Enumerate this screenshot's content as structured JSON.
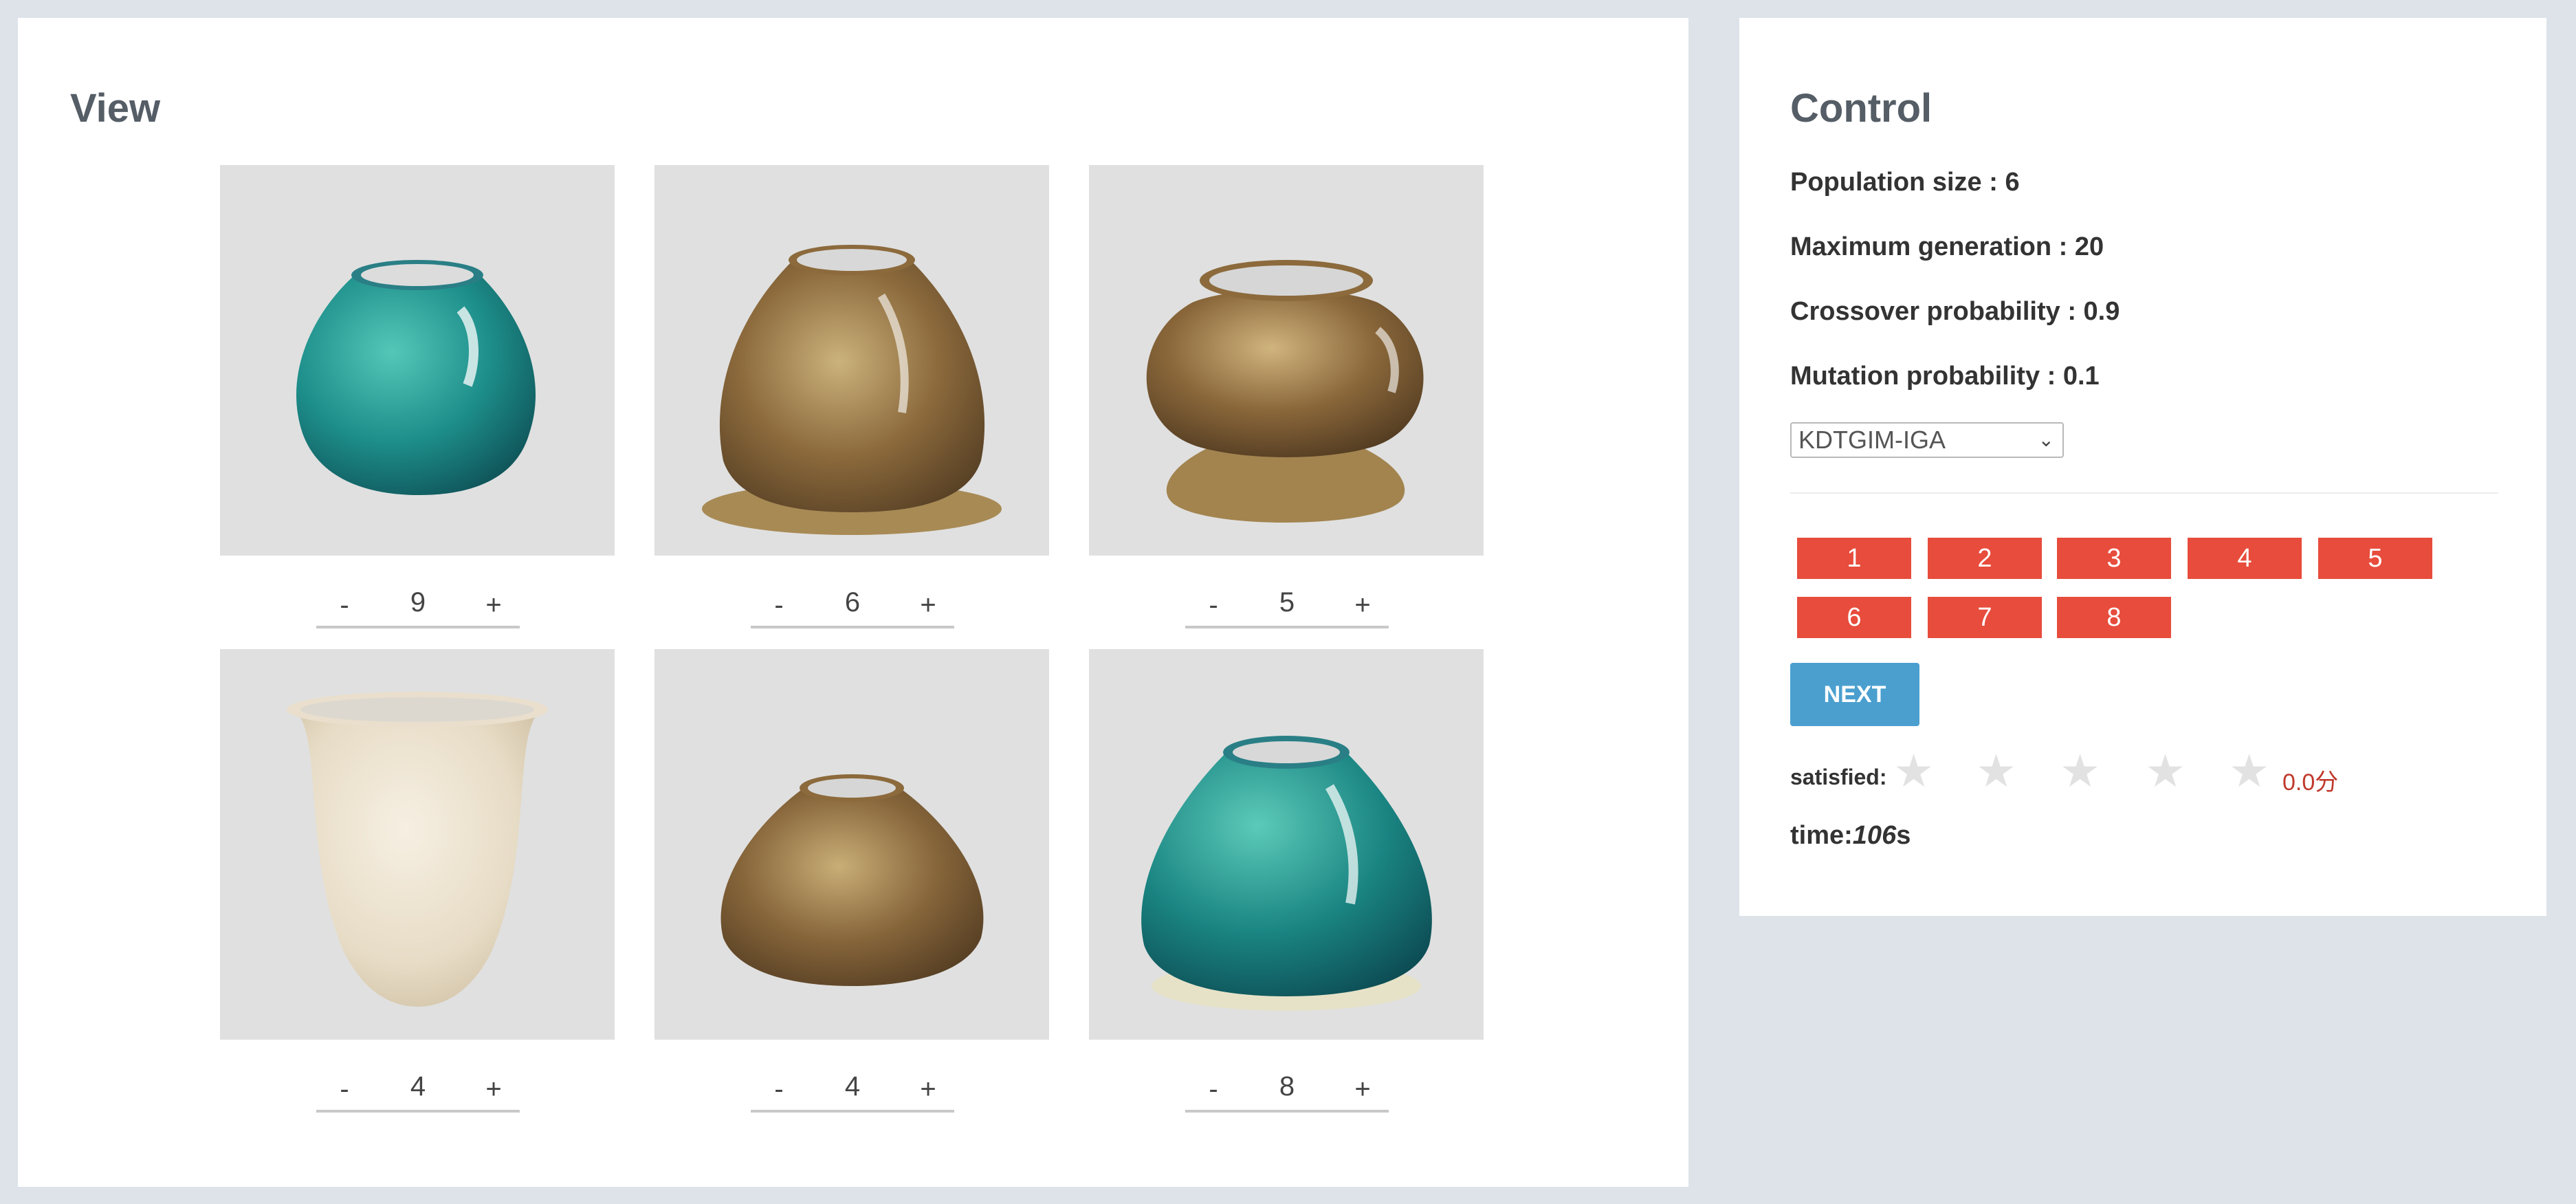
{
  "view": {
    "title": "View",
    "vases": [
      {
        "score": "9",
        "glaze": "teal"
      },
      {
        "score": "6",
        "glaze": "brown-marble"
      },
      {
        "score": "5",
        "glaze": "brown-marble"
      },
      {
        "score": "4",
        "glaze": "cream"
      },
      {
        "score": "4",
        "glaze": "brown-marble"
      },
      {
        "score": "8",
        "glaze": "teal"
      }
    ],
    "stepper": {
      "minus": "-",
      "plus": "+"
    }
  },
  "control": {
    "title": "Control",
    "population_size": "Population size : 6",
    "max_generation": "Maximum generation : 20",
    "crossover": "Crossover probability : 0.9",
    "mutation": "Mutation probability : 0.1",
    "algorithm": "KDTGIM-IGA",
    "numbers": [
      "1",
      "2",
      "3",
      "4",
      "5",
      "6",
      "7",
      "8"
    ],
    "next_label": "NEXT",
    "satisfied_label": "satisfied:",
    "stars": 0,
    "score_text": "0.0分",
    "time_label": "time:",
    "time_value": "106",
    "time_unit": "s"
  },
  "colors": {
    "number_button": "#e74c3c",
    "next_button": "#4a9fcf",
    "teal_glaze": "#1b8a86",
    "brown_glaze": "#8c6a3c",
    "cream_glaze": "#ece3d2"
  }
}
